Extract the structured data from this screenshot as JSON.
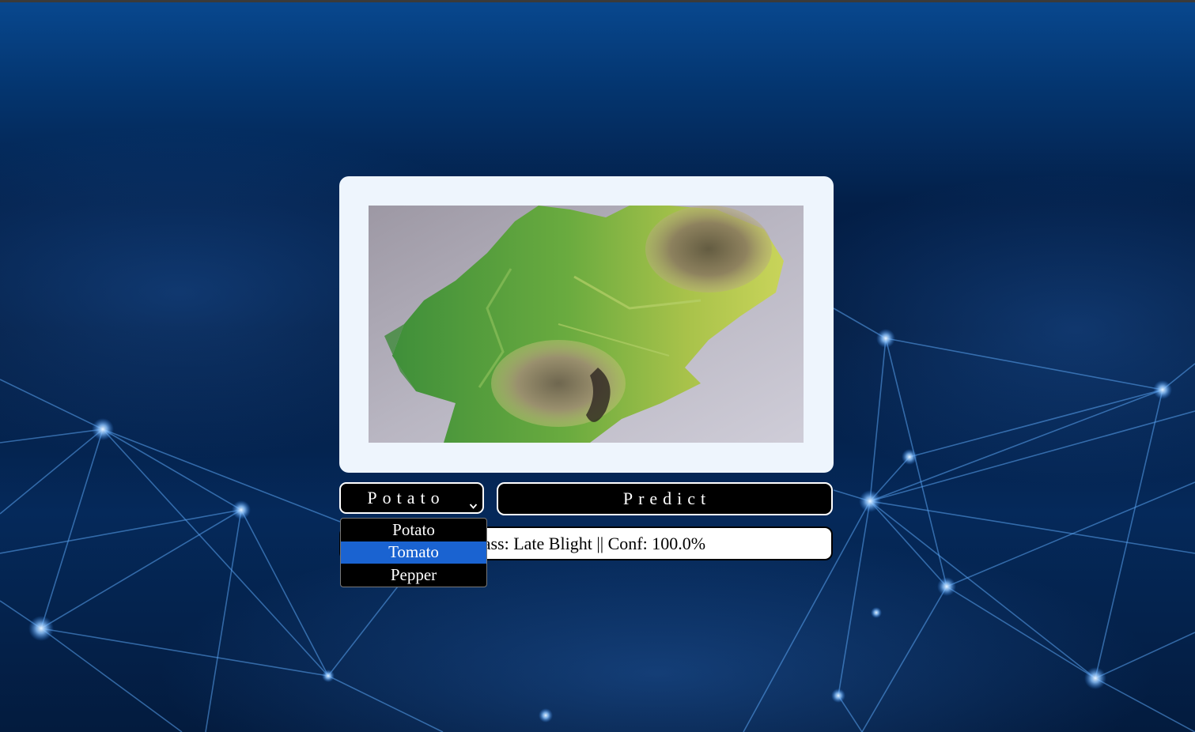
{
  "crop_select": {
    "selected": "Potato",
    "options": [
      "Potato",
      "Tomato",
      "Pepper"
    ],
    "highlighted_index": 1
  },
  "predict_button": {
    "label": "Predict"
  },
  "result": {
    "text": "Class: Late Blight || Conf: 100.0%"
  },
  "icons": {
    "select_arrow": "chevron-down-icon"
  },
  "colors": {
    "card_bg": "#eef5fd",
    "button_bg": "#000000",
    "highlight": "#1a63d1",
    "background_top": "#08488f"
  }
}
